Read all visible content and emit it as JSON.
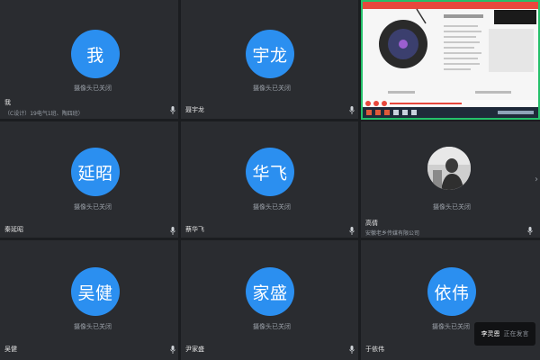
{
  "participants": [
    {
      "avatar_text": "我",
      "name": "我",
      "subtitle": "（C设计）19电气1班、陶四班）",
      "camera_status": "摄像头已关闭"
    },
    {
      "avatar_text": "宇龙",
      "name": "聂宇龙",
      "subtitle": "",
      "camera_status": "摄像头已关闭"
    },
    {
      "avatar_text": "延昭",
      "name": "秦延昭",
      "subtitle": "",
      "camera_status": "摄像头已关闭"
    },
    {
      "avatar_text": "华飞",
      "name": "蔡华飞",
      "subtitle": "",
      "camera_status": "摄像头已关闭"
    },
    {
      "avatar_text": "",
      "name": "高倩",
      "subtitle": "安徽老乡传媒有限公司",
      "camera_status": "摄像头已关闭"
    },
    {
      "avatar_text": "吴健",
      "name": "吴健",
      "subtitle": "",
      "camera_status": "摄像头已关闭"
    },
    {
      "avatar_text": "家盛",
      "name": "尹家盛",
      "subtitle": "",
      "camera_status": "摄像头已关闭"
    },
    {
      "avatar_text": "依伟",
      "name": "于依伟",
      "subtitle": "",
      "camera_status": "摄像头已关闭"
    }
  ],
  "speaking": {
    "name": "李灵恩",
    "status": "正在发言"
  },
  "colors": {
    "tile_bg": "#2a2c30",
    "avatar_blue": "#2b8ff0",
    "share_border": "#25c06a"
  }
}
